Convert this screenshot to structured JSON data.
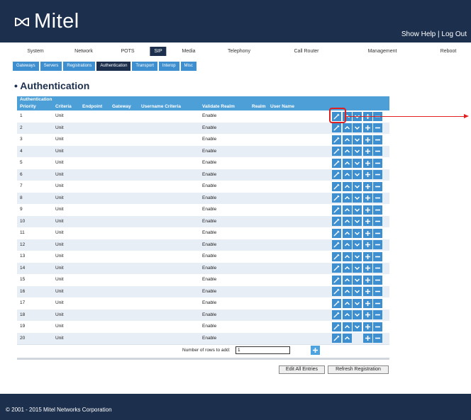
{
  "header": {
    "brand": "Mitel",
    "show_help": "Show Help",
    "separator": "|",
    "log_out": "Log Out"
  },
  "main_nav": [
    "System",
    "Network",
    "POTS",
    "SIP",
    "Media",
    "Telephony",
    "Call Router",
    "Management",
    "Reboot"
  ],
  "main_nav_active": "SIP",
  "sub_nav": [
    "Gateways",
    "Servers",
    "Registrations",
    "Authentication",
    "Transport",
    "Interop",
    "Misc"
  ],
  "sub_nav_active": "Authentication",
  "section": {
    "title": "Authentication",
    "bullet": "•"
  },
  "table": {
    "caption": "Authentication",
    "columns": [
      "Priority",
      "Criteria",
      "Endpoint",
      "Gateway",
      "Username Criteria",
      "Validate Realm",
      "Realm",
      "User Name"
    ],
    "rows": [
      {
        "priority": "1",
        "criteria": "Unit",
        "validate": "Enable"
      },
      {
        "priority": "2",
        "criteria": "Unit",
        "validate": "Enable"
      },
      {
        "priority": "3",
        "criteria": "Unit",
        "validate": "Enable"
      },
      {
        "priority": "4",
        "criteria": "Unit",
        "validate": "Enable"
      },
      {
        "priority": "5",
        "criteria": "Unit",
        "validate": "Enable"
      },
      {
        "priority": "6",
        "criteria": "Unit",
        "validate": "Enable"
      },
      {
        "priority": "7",
        "criteria": "Unit",
        "validate": "Enable"
      },
      {
        "priority": "8",
        "criteria": "Unit",
        "validate": "Enable"
      },
      {
        "priority": "9",
        "criteria": "Unit",
        "validate": "Enable"
      },
      {
        "priority": "10",
        "criteria": "Unit",
        "validate": "Enable"
      },
      {
        "priority": "11",
        "criteria": "Unit",
        "validate": "Enable"
      },
      {
        "priority": "12",
        "criteria": "Unit",
        "validate": "Enable"
      },
      {
        "priority": "13",
        "criteria": "Unit",
        "validate": "Enable"
      },
      {
        "priority": "14",
        "criteria": "Unit",
        "validate": "Enable"
      },
      {
        "priority": "15",
        "criteria": "Unit",
        "validate": "Enable"
      },
      {
        "priority": "16",
        "criteria": "Unit",
        "validate": "Enable"
      },
      {
        "priority": "17",
        "criteria": "Unit",
        "validate": "Enable"
      },
      {
        "priority": "18",
        "criteria": "Unit",
        "validate": "Enable"
      },
      {
        "priority": "19",
        "criteria": "Unit",
        "validate": "Enable"
      },
      {
        "priority": "20",
        "criteria": "Unit",
        "validate": "Enable"
      }
    ],
    "row_actions": [
      "edit-icon",
      "move-up-icon",
      "move-down-icon",
      "add-icon",
      "delete-icon"
    ],
    "rows_to_add_label": "Number of rows to add:",
    "rows_to_add_value": "1"
  },
  "buttons": {
    "edit_all": "Edit All Entries",
    "refresh": "Refresh Registration"
  },
  "footer": {
    "copyright": "© 2001 - 2015 Mitel Networks Corporation"
  },
  "colors": {
    "header_bg": "#1c2f4d",
    "table_header": "#4d9fd8",
    "action_button": "#3d8fd0",
    "row_alt": "#e8eef6",
    "annotation": "#e02020"
  }
}
